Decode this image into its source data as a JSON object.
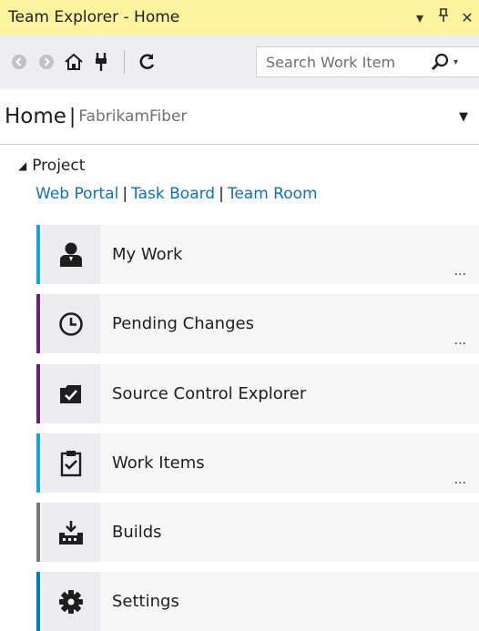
{
  "window": {
    "title": "Team Explorer - Home",
    "controls": [
      "▾",
      "ᛘ",
      "✕"
    ]
  },
  "toolbar": {
    "search_placeholder": "Search Work Item"
  },
  "header": {
    "title": "Home",
    "separator": "|",
    "project": "FabrikamFiber"
  },
  "project_section": {
    "heading": "Project",
    "links": [
      "Web Portal",
      "Task Board",
      "Team Room"
    ]
  },
  "tiles": [
    {
      "label": "My Work",
      "icon": "user-icon",
      "accent": "#1ba1e2",
      "more": "..."
    },
    {
      "label": "Pending Changes",
      "icon": "clock-icon",
      "accent": "#68217a",
      "more": "..."
    },
    {
      "label": "Source Control Explorer",
      "icon": "folder-check-icon",
      "accent": "#68217a",
      "more": ""
    },
    {
      "label": "Work Items",
      "icon": "clipboard-check-icon",
      "accent": "#1ba1e2",
      "more": "..."
    },
    {
      "label": "Builds",
      "icon": "build-icon",
      "accent": "#7a7a7a",
      "more": ""
    },
    {
      "label": "Settings",
      "icon": "gear-icon",
      "accent": "#007acc",
      "more": ""
    }
  ]
}
